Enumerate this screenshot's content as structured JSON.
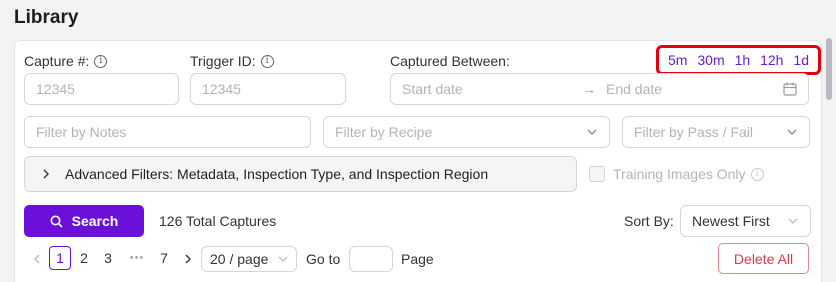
{
  "page": {
    "title": "Library"
  },
  "filters": {
    "capture_label": "Capture #:",
    "capture_placeholder": "12345",
    "trigger_label": "Trigger ID:",
    "trigger_placeholder": "12345",
    "captured_between_label": "Captured Between:",
    "start_placeholder": "Start date",
    "end_placeholder": "End date",
    "range_arrow": "→",
    "quick_ranges": [
      "5m",
      "30m",
      "1h",
      "12h",
      "1d"
    ],
    "notes_placeholder": "Filter by Notes",
    "recipe_placeholder": "Filter by Recipe",
    "passfail_placeholder": "Filter by Pass / Fail",
    "advanced_label": "Advanced Filters: Metadata, Inspection Type, and Inspection Region",
    "training_only_label": "Training Images Only"
  },
  "results": {
    "search_label": "Search",
    "total_captures": "126 Total Captures",
    "sort_by_label": "Sort By:",
    "sort_value": "Newest First"
  },
  "pagination": {
    "pages": [
      "1",
      "2",
      "3",
      "7"
    ],
    "ellipsis": "•••",
    "active_page": "1",
    "page_size": "20 / page",
    "goto_label": "Go to",
    "page_label": "Page"
  },
  "actions": {
    "delete_all_label": "Delete All"
  },
  "colors": {
    "accent": "#6a10d8",
    "highlight_border": "#e00010",
    "danger": "#d83c4a"
  },
  "icons": [
    "info-icon",
    "calendar-icon",
    "chevron-down-icon",
    "chevron-right-icon",
    "search-icon",
    "chevron-left-icon"
  ]
}
